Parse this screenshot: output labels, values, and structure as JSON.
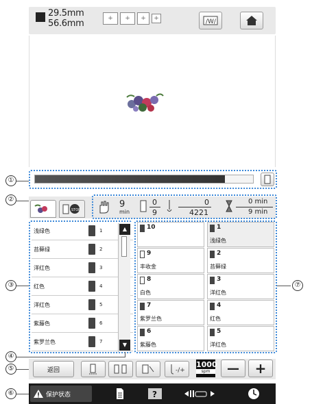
{
  "header": {
    "width_value": "29.5mm",
    "height_value": "56.6mm",
    "frame_buttons": [
      "+",
      "+",
      "+",
      "+"
    ],
    "home_label": "home"
  },
  "callouts": [
    "①",
    "②",
    "③",
    "④",
    "⑤",
    "⑥",
    "⑦"
  ],
  "progress": {
    "fraction": 0.87
  },
  "info": {
    "time_value": "9",
    "time_unit": "min",
    "color_count": "0",
    "color_total": "9",
    "stitch_done": "0",
    "stitch_total": "4221",
    "time_done": "0 min",
    "time_total": "9 min"
  },
  "thread_list": [
    {
      "name": "浅绿色",
      "n": "1"
    },
    {
      "name": "苔藓绿",
      "n": "2"
    },
    {
      "name": "洋红色",
      "n": "3"
    },
    {
      "name": "红色",
      "n": "4"
    },
    {
      "name": "洋红色",
      "n": "5"
    },
    {
      "name": "紫藤色",
      "n": "6"
    },
    {
      "name": "紫罗兰色",
      "n": "7"
    }
  ],
  "spool_grid": [
    {
      "n": "10",
      "label": ""
    },
    {
      "n": "1",
      "label": "浅绿色"
    },
    {
      "n": "9",
      "label": "丰收金"
    },
    {
      "n": "2",
      "label": "苔藓绿"
    },
    {
      "n": "8",
      "label": "白色"
    },
    {
      "n": "3",
      "label": "洋红色"
    },
    {
      "n": "7",
      "label": "紫罗兰色"
    },
    {
      "n": "4",
      "label": "红色"
    },
    {
      "n": "6",
      "label": "紫藤色"
    },
    {
      "n": "5",
      "label": "洋红色"
    }
  ],
  "bottom": {
    "back_label": "返回",
    "speed_value": "1000",
    "speed_unit": "spm",
    "minus": "—",
    "plus": "+"
  },
  "status": {
    "protect_label": "保护状态"
  },
  "colors": {
    "bar_bg": "#e9e9e9",
    "callout": "#3a87d8",
    "status_bg": "#1a1a1a"
  }
}
